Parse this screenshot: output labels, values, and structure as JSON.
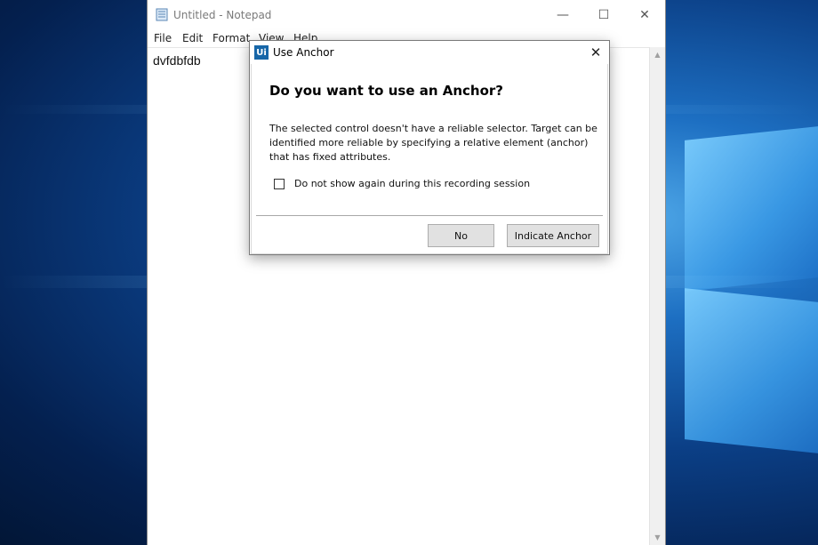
{
  "notepad": {
    "title": "Untitled - Notepad",
    "menu": [
      "File",
      "Edit",
      "Format",
      "View",
      "Help"
    ],
    "content": "dvfdbfdb",
    "controls": {
      "minimize": "—",
      "maximize": "☐",
      "close": "✕"
    }
  },
  "dialog": {
    "icon_text": "Ui",
    "title": "Use Anchor",
    "heading": "Do you want to use an Anchor?",
    "message": "The selected control doesn't have a reliable selector. Target can be identified more reliable by specifying a relative element (anchor) that has fixed attributes.",
    "checkbox_label": "Do not show again during this recording session",
    "checkbox_checked": false,
    "buttons": {
      "no": "No",
      "indicate": "Indicate Anchor"
    },
    "close_glyph": "✕"
  },
  "colors": {
    "dialog_icon_bg": "#1766a8",
    "desktop_accent": "#1d6fc2"
  }
}
